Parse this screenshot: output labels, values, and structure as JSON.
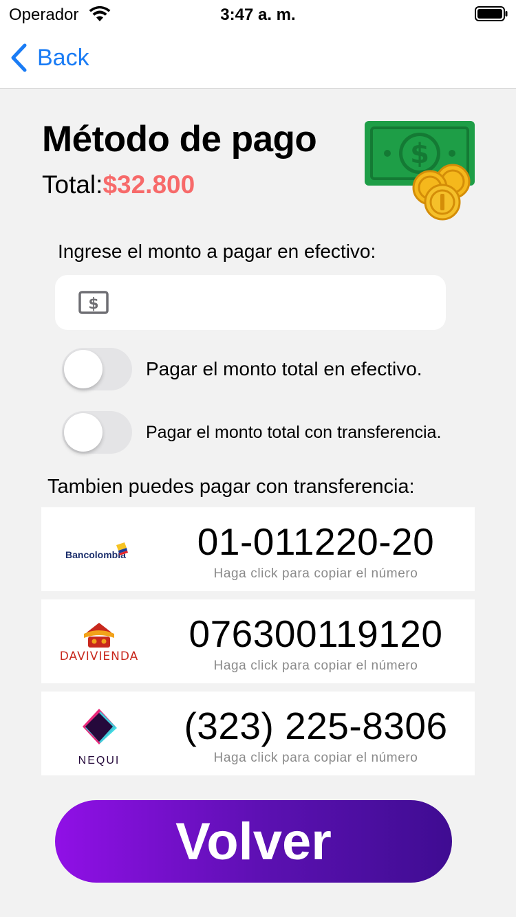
{
  "status_bar": {
    "carrier": "Operador",
    "time": "3:47 a. m."
  },
  "nav": {
    "back_label": "Back"
  },
  "header": {
    "title": "Método de pago",
    "total_label": "Total:",
    "total_value": "$32.800"
  },
  "cash": {
    "label": "Ingrese el monto a pagar en efectivo:",
    "input_value": "",
    "placeholder": ""
  },
  "toggles": [
    {
      "label": "Pagar el monto total en efectivo.",
      "on": false
    },
    {
      "label": "Pagar el monto total con transferencia.",
      "on": false
    }
  ],
  "transfer": {
    "label": "Tambien puedes pagar con transferencia:",
    "banks": [
      {
        "name": "Bancolombia",
        "logo_text": "Bancolombia",
        "number": "01-011220-20",
        "hint": "Haga click para copiar el número"
      },
      {
        "name": "Davivienda",
        "logo_text": "DAVIVIENDA",
        "number": "076300119120",
        "hint": "Haga click para copiar el número"
      },
      {
        "name": "Nequi",
        "logo_text": "NEQUI",
        "number": "(323) 225-8306",
        "hint": "Haga click para copiar el número"
      }
    ]
  },
  "volver_label": "Volver",
  "colors": {
    "accent_blue": "#1a7cf5",
    "total_red": "#f76a6a",
    "button_start": "#9010e6",
    "button_end": "#3f0c92"
  }
}
